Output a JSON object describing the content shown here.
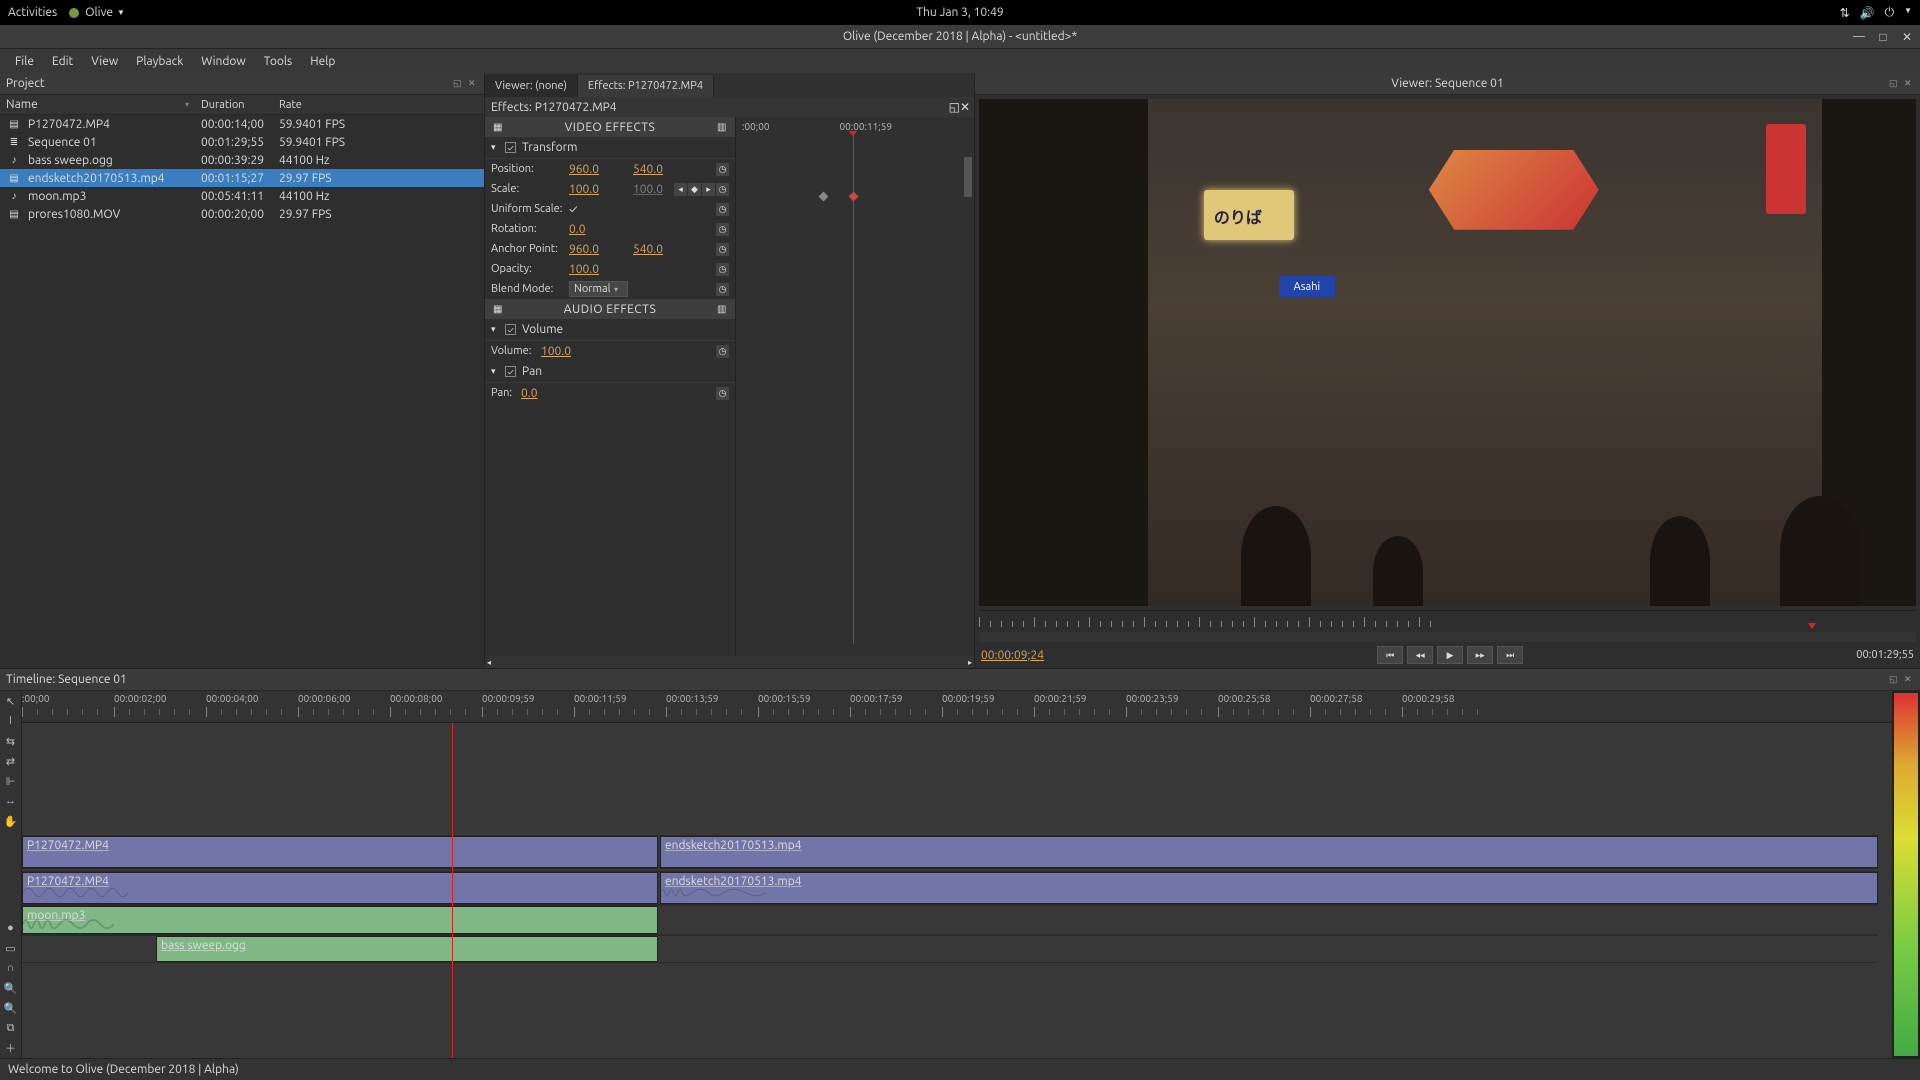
{
  "topbar": {
    "activities": "Activities",
    "app": "Olive",
    "datetime": "Thu Jan  3, 10:49"
  },
  "window_title": "Olive (December 2018 | Alpha) - <untitled>*",
  "menu": [
    "File",
    "Edit",
    "View",
    "Playback",
    "Window",
    "Tools",
    "Help"
  ],
  "project": {
    "title": "Project",
    "cols": {
      "name": "Name",
      "duration": "Duration",
      "rate": "Rate"
    },
    "items": [
      {
        "name": "P1270472.MP4",
        "dur": "00:00:14;00",
        "rate": "59.9401 FPS",
        "type": "video"
      },
      {
        "name": "Sequence 01",
        "dur": "00:01:29;55",
        "rate": "59.9401 FPS",
        "type": "seq"
      },
      {
        "name": "bass sweep.ogg",
        "dur": "00:00:39:29",
        "rate": "44100 Hz",
        "type": "audio"
      },
      {
        "name": "endsketch20170513.mp4",
        "dur": "00:01:15;27",
        "rate": "29.97 FPS",
        "type": "video",
        "selected": true
      },
      {
        "name": "moon.mp3",
        "dur": "00:05:41:11",
        "rate": "44100 Hz",
        "type": "audio"
      },
      {
        "name": "prores1080.MOV",
        "dur": "00:00:20;00",
        "rate": "29.97 FPS",
        "type": "video"
      }
    ]
  },
  "viewer_tab": "Viewer:  (none)",
  "effects_tab": "Effects: P1270472.MP4",
  "effects_title": "Effects: P1270472.MP4",
  "fx": {
    "video_header": "VIDEO EFFECTS",
    "audio_header": "AUDIO EFFECTS",
    "transform": "Transform",
    "volume_grp": "Volume",
    "pan_grp": "Pan",
    "position_lbl": "Position:",
    "position_x": "960.0",
    "position_y": "540.0",
    "scale_lbl": "Scale:",
    "scale_x": "100.0",
    "scale_y": "100.0",
    "uniform_lbl": "Uniform Scale:",
    "rotation_lbl": "Rotation:",
    "rotation": "0.0",
    "anchor_lbl": "Anchor Point:",
    "anchor_x": "960.0",
    "anchor_y": "540.0",
    "opacity_lbl": "Opacity:",
    "opacity": "100.0",
    "blend_lbl": "Blend Mode:",
    "blend": "Normal",
    "volume_lbl": "Volume:",
    "volume": "100.0",
    "pan_lbl": "Pan:",
    "pan": "0.0",
    "kf_ruler_start": ":00;00",
    "kf_ruler_end": "00:00:11;59"
  },
  "viewer": {
    "title": "Viewer: Sequence 01",
    "tc": "00:00:09;24",
    "dur": "00:01:29;55",
    "scene_text": {
      "asahi": "Asahi"
    }
  },
  "timeline": {
    "title": "Timeline: Sequence 01",
    "ticks": [
      ":00;00",
      "00:00:02;00",
      "00:00:04;00",
      "00:00:06;00",
      "00:00:08;00",
      "00:00:09;59",
      "00:00:11;59",
      "00:00:13;59",
      "00:00:15;59",
      "00:00:17;59",
      "00:00:19;59",
      "00:00:21;59",
      "00:00:23;59",
      "00:00:25;58",
      "00:00:27;58",
      "00:00:29;58"
    ],
    "clips": {
      "v1a": "P1270472.MP4",
      "v1b": "endsketch20170513.mp4",
      "a1a": "P1270472.MP4",
      "a1b": "endsketch20170513.mp4",
      "a2": "moon.mp3",
      "a3": "bass sweep.ogg"
    }
  },
  "status": "Welcome to Olive (December 2018 | Alpha)"
}
